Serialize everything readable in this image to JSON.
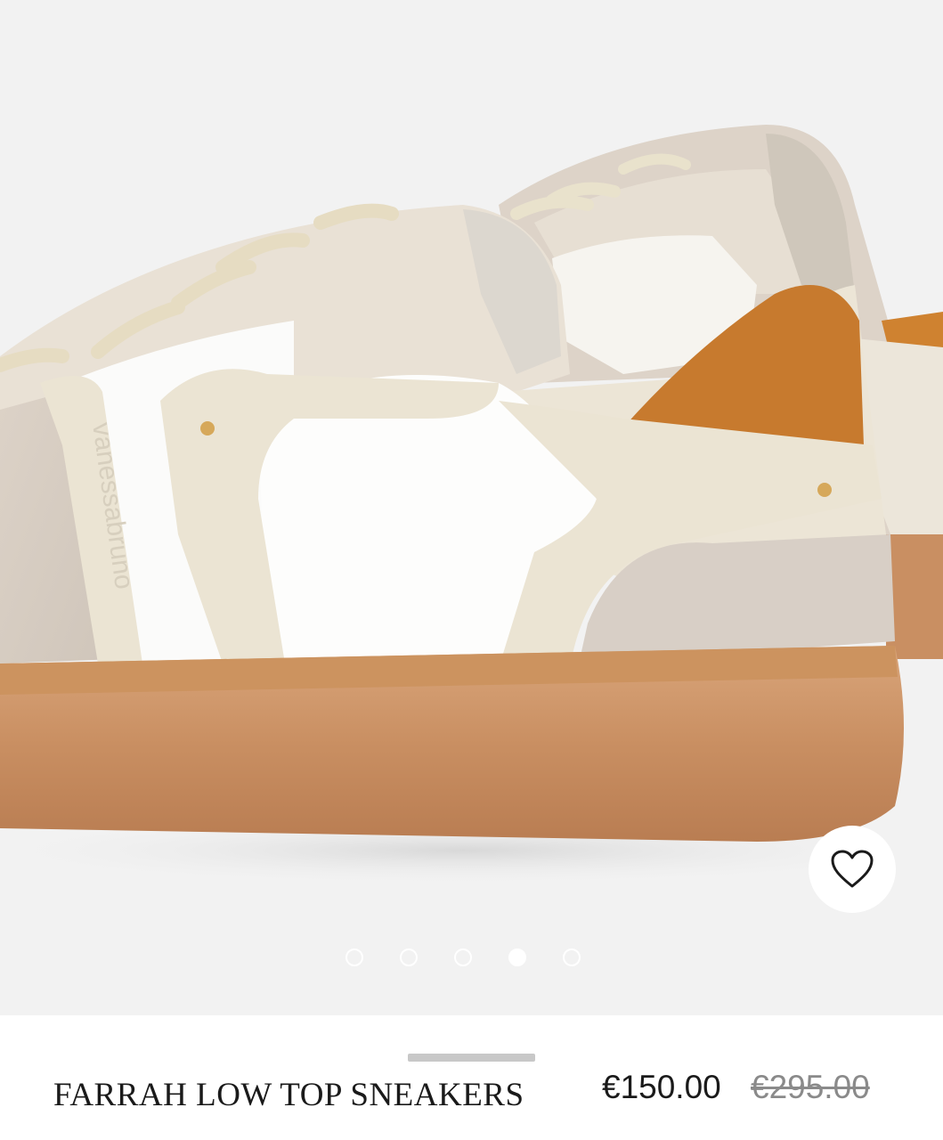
{
  "product": {
    "title": "FARRAH LOW TOP SNEAKERS",
    "price": "€150.00",
    "original_price": "€295.00",
    "brand_emboss": "vanessabruno"
  },
  "gallery": {
    "image": "sneaker-side-rear-view",
    "slide_count": 5,
    "active_slide": 4,
    "wishlist_icon": "heart-icon"
  },
  "colors": {
    "background": "#f2f2f2",
    "gum_sole": "#c98f62",
    "suede_tab": "#c77a2e",
    "leather_cream": "#ede6d6",
    "text": "#1a1a1a",
    "strike_price": "#8a8a8a"
  }
}
